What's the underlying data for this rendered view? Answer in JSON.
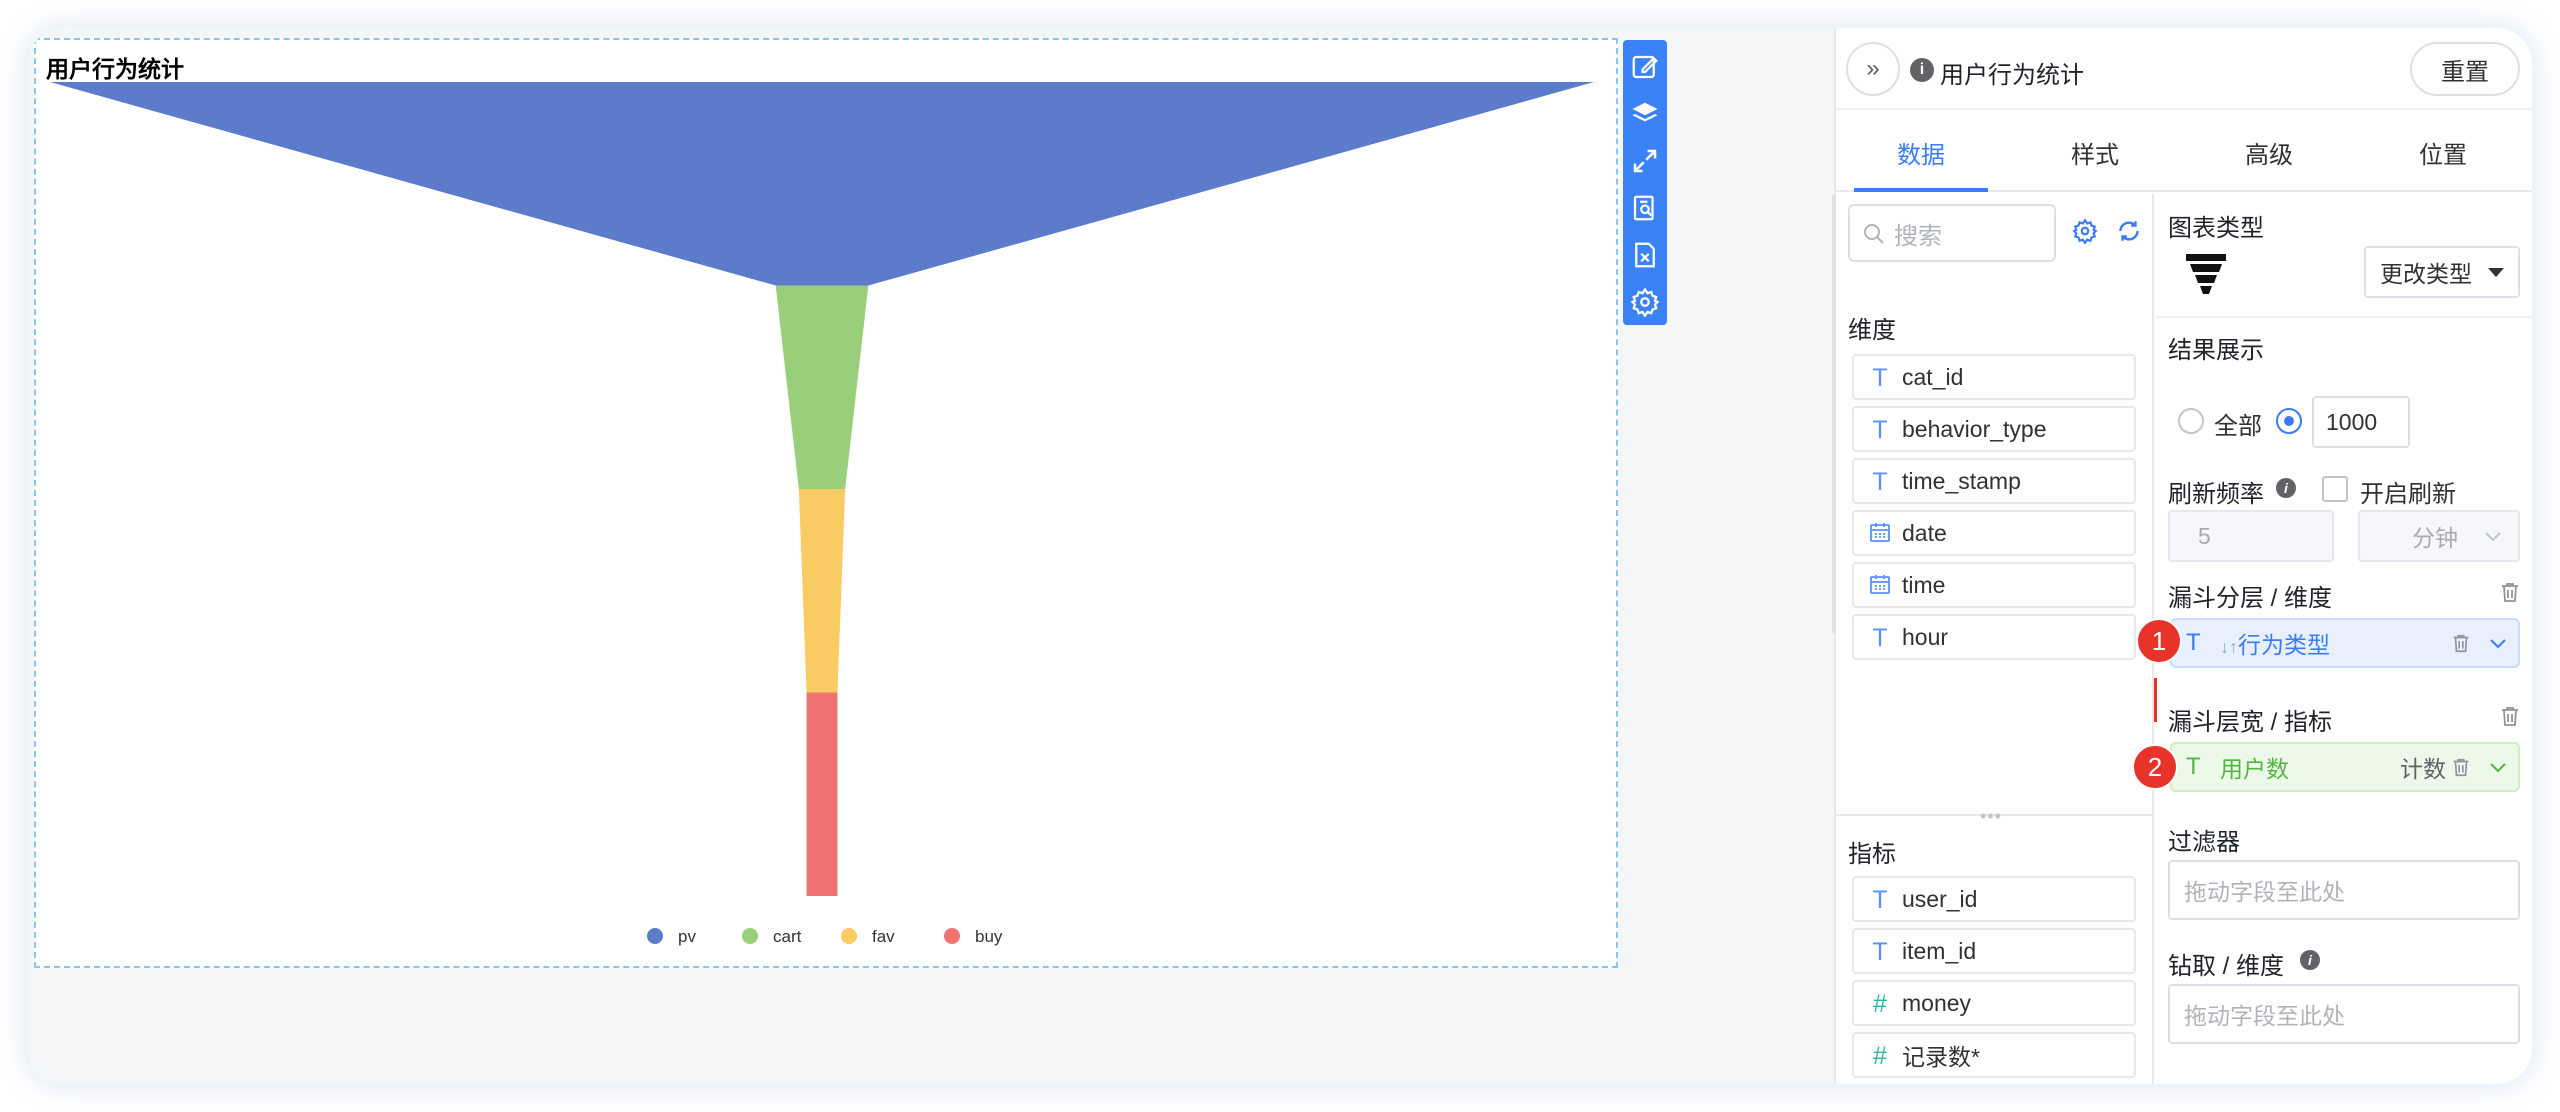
{
  "chart": {
    "title": "用户行为统计"
  },
  "chart_data": {
    "type": "funnel",
    "title": "用户行为统计",
    "categories": [
      "pv",
      "cart",
      "fav",
      "buy"
    ],
    "values": [
      100,
      6,
      3,
      2
    ],
    "colors": [
      "#5d7bcb",
      "#99cf7a",
      "#f8cb63",
      "#f07271"
    ],
    "legend": {
      "position": "bottom-center",
      "items": [
        "pv",
        "cart",
        "fav",
        "buy"
      ]
    }
  },
  "toolbar": {
    "icons": [
      "edit-icon",
      "layers-icon",
      "expand-icon",
      "search-doc-icon",
      "close-doc-icon",
      "gear-icon"
    ]
  },
  "panel": {
    "title": "用户行为统计",
    "reset_label": "重置",
    "tabs": [
      "数据",
      "样式",
      "高级",
      "位置"
    ],
    "active_tab": "数据"
  },
  "fields": {
    "search_placeholder": "搜索",
    "dimension_label": "维度",
    "dimensions": [
      {
        "type": "T",
        "name": "cat_id"
      },
      {
        "type": "T",
        "name": "behavior_type"
      },
      {
        "type": "T",
        "name": "time_stamp"
      },
      {
        "type": "date",
        "name": "date"
      },
      {
        "type": "date",
        "name": "time"
      },
      {
        "type": "T",
        "name": "hour"
      }
    ],
    "metric_label": "指标",
    "metrics": [
      {
        "type": "T",
        "name": "user_id"
      },
      {
        "type": "T",
        "name": "item_id"
      },
      {
        "type": "#",
        "name": "money"
      },
      {
        "type": "#",
        "name": "记录数*"
      }
    ]
  },
  "settings": {
    "chart_type_label": "图表类型",
    "change_type_label": "更改类型",
    "result_label": "结果展示",
    "all_label": "全部",
    "result_count": "1000",
    "refresh_label": "刷新频率",
    "enable_refresh_label": "开启刷新",
    "refresh_value": "5",
    "refresh_unit": "分钟",
    "funnel_layer_label": "漏斗分层 / 维度",
    "funnel_layer_field": "行为类型",
    "funnel_width_label": "漏斗层宽 / 指标",
    "funnel_width_field": "用户数",
    "funnel_width_agg": "计数",
    "filter_label": "过滤器",
    "filter_placeholder": "拖动字段至此处",
    "drill_label": "钻取 / 维度",
    "drill_placeholder": "拖动字段至此处",
    "badge1": "1",
    "badge2": "2"
  }
}
